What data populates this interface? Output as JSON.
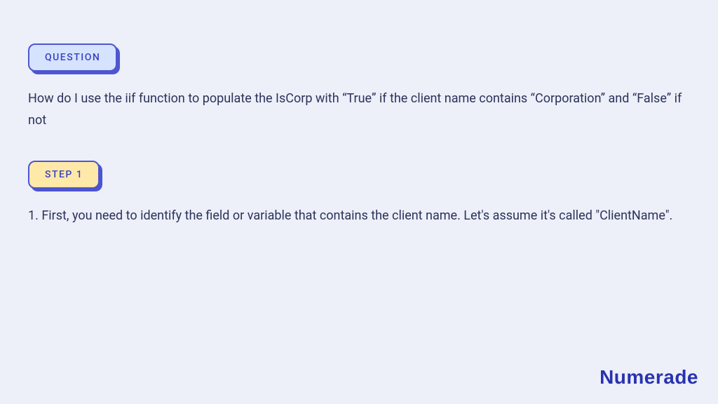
{
  "badges": {
    "question": "QUESTION",
    "step1": "STEP 1"
  },
  "question_text": "How do I use the iif function to populate the IsCorp with “True” if the client name contains “Corporation” and “False” if not",
  "step1_text": "1. First, you need to identify the field or variable that contains the client name. Let's assume it's called \"ClientName\".",
  "brand": "Numerade"
}
